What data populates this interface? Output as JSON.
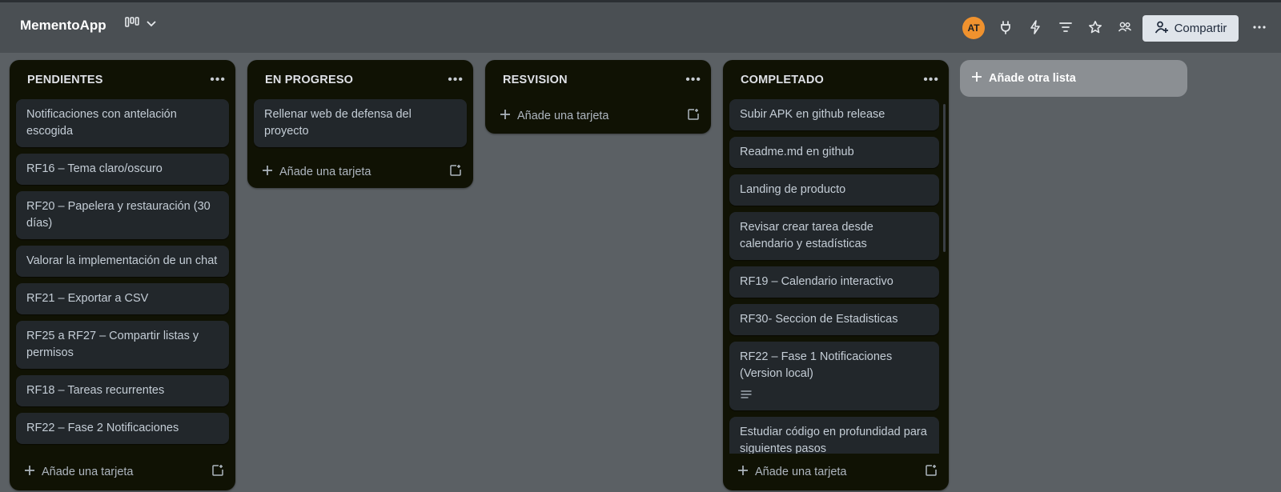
{
  "header": {
    "app_title": "MementoApp",
    "avatar_initials": "AT",
    "share_label": "Compartir"
  },
  "lists": [
    {
      "title": "PENDIENTES",
      "cards": [
        "Notificaciones con antelación escogida",
        "RF16 – Tema claro/oscuro",
        "RF20 – Papelera y restauración (30 días)",
        "Valorar la implementación de un chat",
        "RF21 – Exportar a CSV",
        "RF25 a RF27 – Compartir listas y permisos",
        "RF18 – Tareas recurrentes",
        "RF22 – Fase 2 Notificaciones"
      ],
      "add_card_label": "Añade una tarjeta"
    },
    {
      "title": "EN PROGRESO",
      "cards": [
        "Rellenar web de defensa del proyecto"
      ],
      "add_card_label": "Añade una tarjeta"
    },
    {
      "title": "RESVISION",
      "cards": [],
      "add_card_label": "Añade una tarjeta"
    },
    {
      "title": "COMPLETADO",
      "cards": [
        "Subir APK en github release",
        "Readme.md en github",
        "Landing de producto",
        "Revisar crear tarea desde calendario y estadísticas",
        "RF19 – Calendario interactivo",
        "RF30- Seccion de Estadisticas",
        "RF22 – Fase 1 Notificaciones (Version local)",
        "Estudiar código en profundidad para siguientes pasos"
      ],
      "add_card_label": "Añade una tarjeta"
    }
  ],
  "add_list_label": "Añade otra lista",
  "colors": {
    "board_bg": "#5b6064",
    "topbar_bg": "#4a4f53",
    "list_bg": "#101204",
    "card_bg": "#22272b",
    "avatar_bg": "#f0922e",
    "share_bg": "#dfe4ea"
  },
  "icons": {
    "board_view": "board-icon",
    "power_ups": "plug-icon",
    "automation": "lightning-icon",
    "filter": "filter-icon",
    "star": "star-icon",
    "members": "members-icon",
    "share": "add-person-icon",
    "more": "more-icon"
  }
}
